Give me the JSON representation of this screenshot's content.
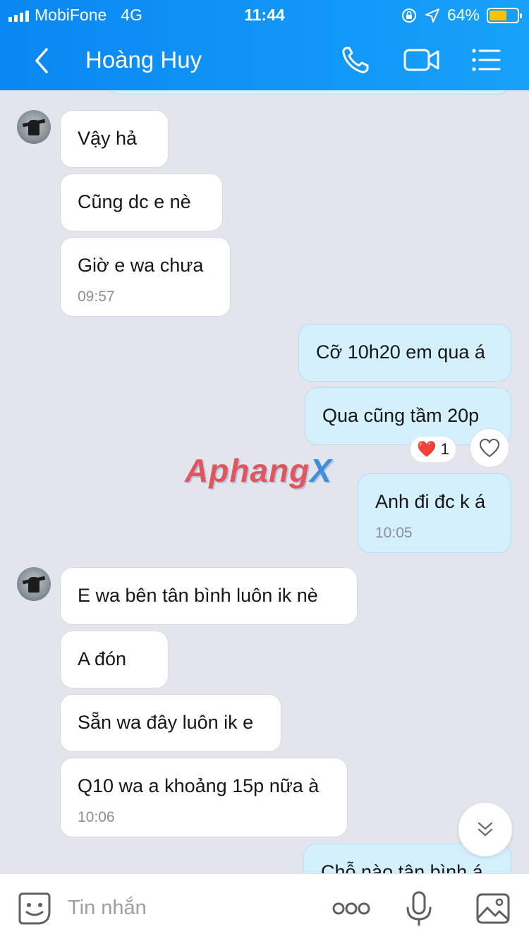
{
  "status_bar": {
    "carrier": "MobiFone",
    "network": "4G",
    "time": "11:44",
    "battery_percent": "64%",
    "battery_level": 0.64
  },
  "header": {
    "contact_name": "Hoàng Huy",
    "colors": {
      "header_start": "#0a87f2",
      "header_end": "#17a1fa"
    }
  },
  "messages": [
    {
      "side": "in",
      "text": "Vậy hả"
    },
    {
      "side": "in",
      "text": "Cũng dc e nè"
    },
    {
      "side": "in",
      "text": "Giờ e wa chưa",
      "time": "09:57"
    },
    {
      "side": "out",
      "text": "Cỡ 10h20 em qua á"
    },
    {
      "side": "out",
      "text": "Qua cũng tầm 20p",
      "reaction": {
        "emoji": "❤️",
        "count": "1"
      }
    },
    {
      "side": "out",
      "text": "Anh đi đc k á",
      "time": "10:05"
    },
    {
      "side": "in",
      "text": "E wa bên tân bình luôn ik nè"
    },
    {
      "side": "in",
      "text": "A đón"
    },
    {
      "side": "in",
      "text": "Sẵn wa đây luôn ik e"
    },
    {
      "side": "in",
      "text": "Q10 wa a khoảng 15p nữa à",
      "time": "10:06"
    },
    {
      "side": "out",
      "text": "Chỗ nào tân bình á"
    }
  ],
  "watermark": {
    "main": "Aphang",
    "accent": "X"
  },
  "composer": {
    "placeholder": "Tin nhắn"
  },
  "icons": {
    "back": "chevron-left-icon",
    "call": "phone-icon",
    "video": "video-camera-icon",
    "menu": "list-menu-icon",
    "sticker": "smiley-sticker-icon",
    "more": "more-dots-icon",
    "voice": "microphone-icon",
    "photo": "image-icon",
    "scroll": "chevron-double-down-icon",
    "react": "heart-outline-icon"
  }
}
